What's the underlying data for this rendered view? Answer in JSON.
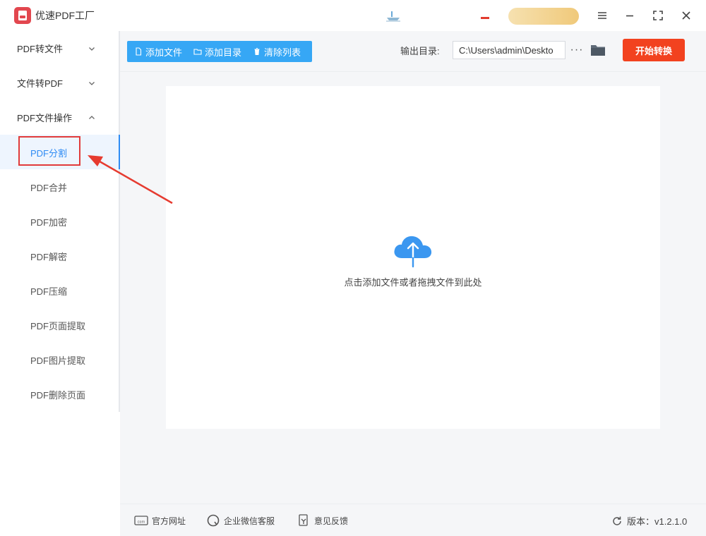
{
  "app": {
    "title": "优速PDF工厂",
    "logo_text": "PDF",
    "promo_text": ""
  },
  "sidebar": {
    "groups": [
      {
        "label": "PDF转文件",
        "expanded": false
      },
      {
        "label": "文件转PDF",
        "expanded": false
      },
      {
        "label": "PDF文件操作",
        "expanded": true
      }
    ],
    "items": [
      {
        "label": "PDF分割",
        "active": true
      },
      {
        "label": "PDF合并"
      },
      {
        "label": "PDF加密"
      },
      {
        "label": "PDF解密"
      },
      {
        "label": "PDF压缩"
      },
      {
        "label": "PDF页面提取"
      },
      {
        "label": "PDF图片提取"
      },
      {
        "label": "PDF删除页面"
      }
    ]
  },
  "toolbar": {
    "add_file": "添加文件",
    "add_folder": "添加目录",
    "clear_list": "清除列表",
    "output_label": "输出目录:",
    "output_path": "C:\\Users\\admin\\Deskto",
    "more": "···",
    "start": "开始转换"
  },
  "drop_zone": {
    "text": "点击添加文件或者拖拽文件到此处"
  },
  "footer": {
    "website": "官方网址",
    "wechat": "企业微信客服",
    "feedback": "意见反馈",
    "version": "版本：v1.2.1.0"
  },
  "colors": {
    "accent": "#36a7f5",
    "start_button": "#f2421f",
    "highlight": "#e13b3b",
    "active_text": "#2f8cf4"
  }
}
